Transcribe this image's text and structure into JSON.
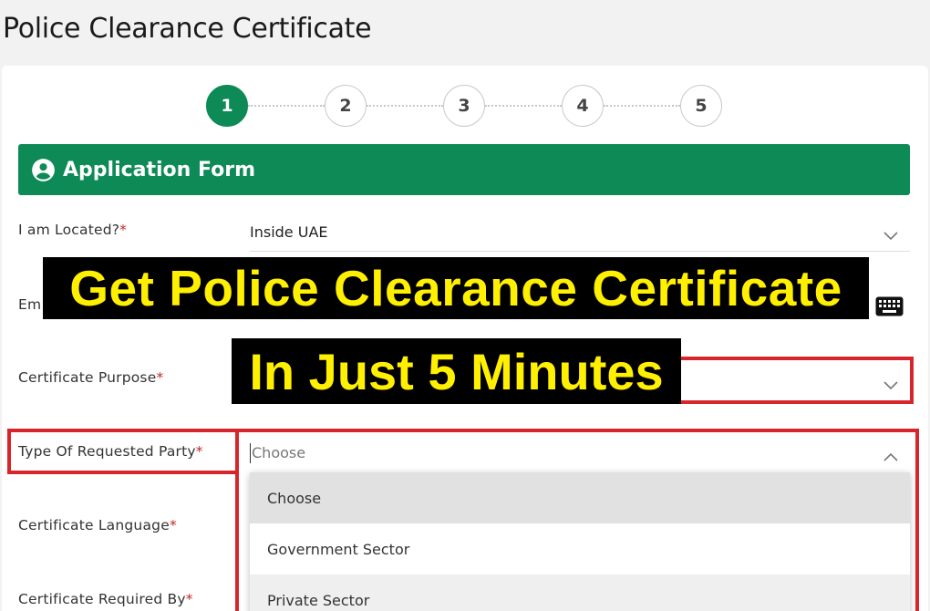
{
  "page": {
    "title": "Police Clearance Certificate"
  },
  "stepper": {
    "steps": [
      "1",
      "2",
      "3",
      "4",
      "5"
    ],
    "active_step": "1"
  },
  "form": {
    "header": "Application Form",
    "fields": {
      "located": {
        "label": "I am Located?",
        "required": "*",
        "value": "Inside UAE"
      },
      "email": {
        "label": "Em"
      },
      "purpose": {
        "label": "Certificate Purpose",
        "required": "*"
      },
      "party": {
        "label": "Type Of Requested Party",
        "required": "*",
        "placeholder": "Choose"
      },
      "language": {
        "label": "Certificate Language",
        "required": "*"
      },
      "required_by": {
        "label": "Certificate Required By",
        "required": "*"
      }
    },
    "dropdown_options": [
      "Choose",
      "Government Sector",
      "Private Sector"
    ]
  },
  "overlay": {
    "line1": "Get Police Clearance Certificate",
    "line2": "In Just 5 Minutes"
  },
  "colors": {
    "accent": "#0d8a56",
    "highlight": "#d7262b",
    "banner_text": "#ffef00"
  },
  "icons": [
    "user-circle-icon",
    "chevron-down-icon",
    "chevron-up-icon",
    "keyboard-icon"
  ]
}
